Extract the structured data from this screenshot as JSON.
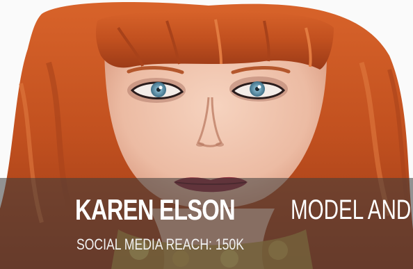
{
  "profile": {
    "name": "KAREN ELSON",
    "role_text": "MODEL AND",
    "reach_text": "SOCIAL MEDIA REACH: 150K"
  },
  "colors": {
    "hair": "#c1501f",
    "skin": "#efc1a9",
    "eyes": "#5e8fa6",
    "lips": "#8e2a3a",
    "overlay": "#3c3c3c"
  }
}
